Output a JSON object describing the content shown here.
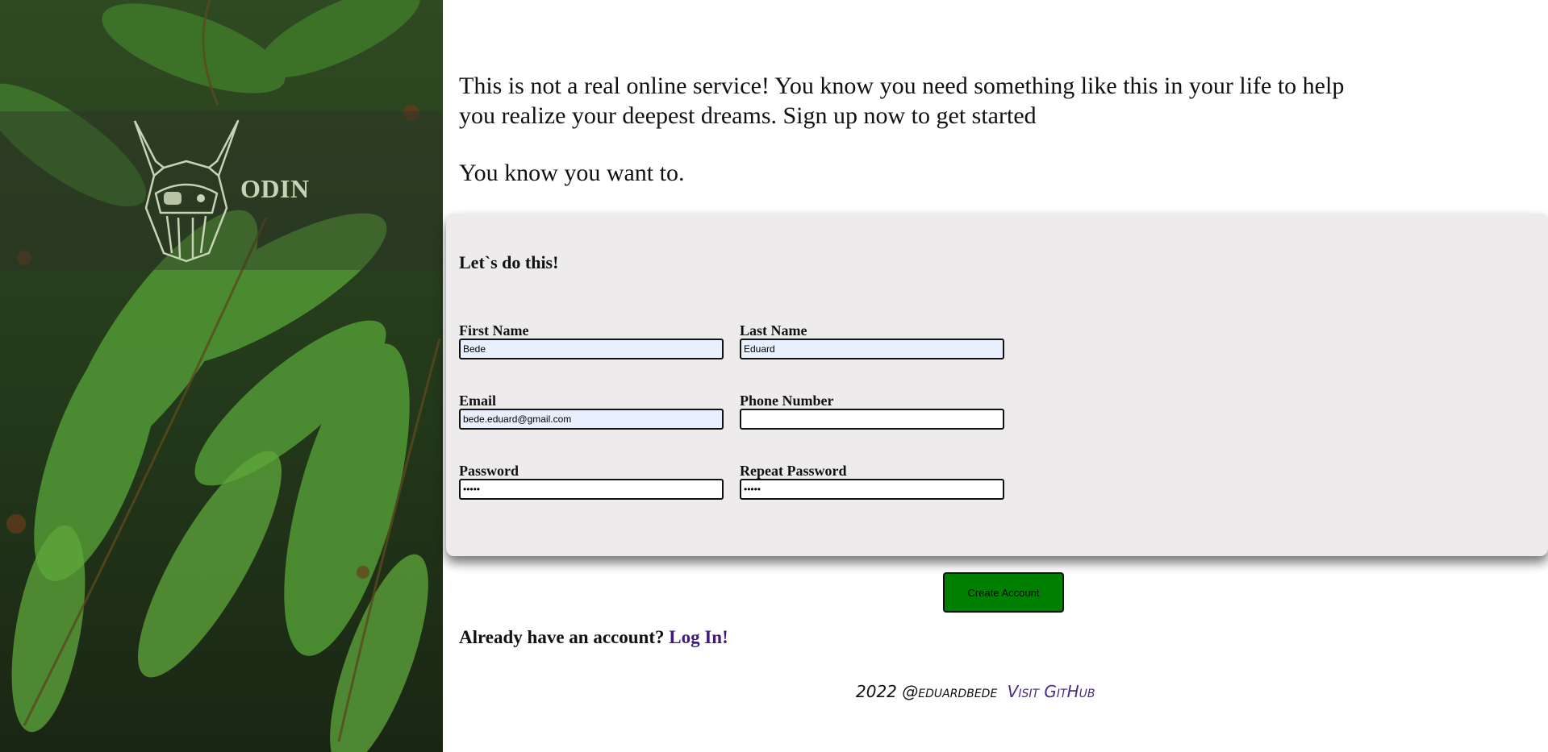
{
  "brand": {
    "logo_text": "ODIN",
    "logo_icon": "odin-viking-head-icon"
  },
  "intro": {
    "line1": "This is not a real online service! You know you need something like this in your life to help you realize your deepest dreams. Sign up now to get started",
    "line2": "You know you want to."
  },
  "form": {
    "heading": "Let`s do this!",
    "first_name": {
      "label": "First Name",
      "value": "Bede"
    },
    "last_name": {
      "label": "Last Name",
      "value": "Eduard"
    },
    "email": {
      "label": "Email",
      "value": "bede.eduard@gmail.com"
    },
    "phone": {
      "label": "Phone Number",
      "value": ""
    },
    "password": {
      "label": "Password",
      "value": "•••••"
    },
    "repeat_password": {
      "label": "Repeat Password",
      "value": "•••••"
    },
    "submit_label": "Create Account"
  },
  "login": {
    "prompt": "Already have an account?",
    "link_label": "Log In!"
  },
  "footer": {
    "copyright": "2022 @eduardbede",
    "github_label": "Visit GitHub"
  },
  "colors": {
    "accent_button": "#008000",
    "link": "#3f1d7a",
    "card_bg": "#edebec",
    "autofill_bg": "#e8f0fe"
  }
}
